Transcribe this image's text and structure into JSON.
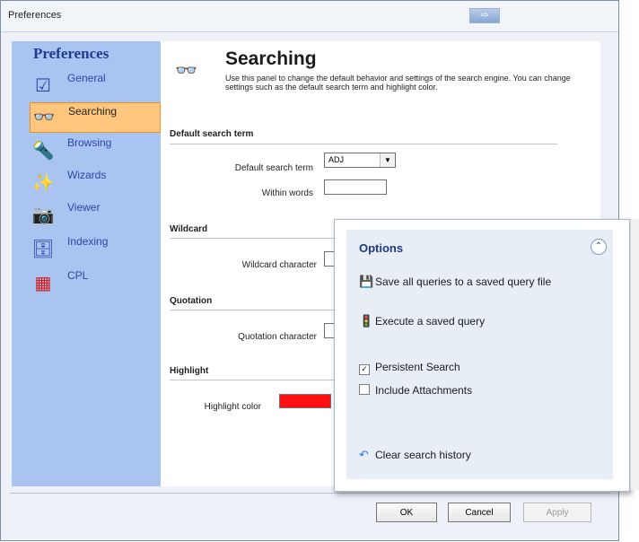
{
  "window": {
    "title": "Preferences"
  },
  "sidebar": {
    "heading": "Preferences",
    "items": [
      {
        "label": "General",
        "icon": "checklist-icon"
      },
      {
        "label": "Searching",
        "icon": "binoculars-icon",
        "selected": true
      },
      {
        "label": "Browsing",
        "icon": "flashlight-icon"
      },
      {
        "label": "Wizards",
        "icon": "wand-icon"
      },
      {
        "label": "Viewer",
        "icon": "camera-icon"
      },
      {
        "label": "Indexing",
        "icon": "database-icon"
      },
      {
        "label": "CPL",
        "icon": "grid-icon"
      }
    ]
  },
  "header": {
    "title": "Searching",
    "description": "Use this panel to change the default behavior and settings of the search engine. You can change settings such as the default search term and highlight color."
  },
  "sections": {
    "default_search_term": {
      "title": "Default search term",
      "term_label": "Default search term",
      "term_value": "ADJ",
      "within_label": "Within words"
    },
    "wildcard": {
      "title": "Wildcard",
      "char_label": "Wildcard character"
    },
    "quotation": {
      "title": "Quotation",
      "char_label": "Quotation character"
    },
    "highlight": {
      "title": "Highlight",
      "color_label": "Highlight color",
      "color": "#ff1010"
    }
  },
  "options": {
    "title": "Options",
    "tasks": [
      {
        "label": "Save all queries to a saved query file",
        "icon": "floppy-disk-icon"
      },
      {
        "label": "Execute a saved query",
        "icon": "traffic-light-icon"
      }
    ],
    "checkboxes": [
      {
        "label": "Persistent Search",
        "checked": true
      },
      {
        "label": "Include Attachments",
        "checked": false
      }
    ],
    "clear_history": {
      "label": "Clear search history",
      "icon": "undo-arrow-icon"
    }
  },
  "footer": {
    "ok": "OK",
    "cancel": "Cancel",
    "apply": "Apply"
  }
}
